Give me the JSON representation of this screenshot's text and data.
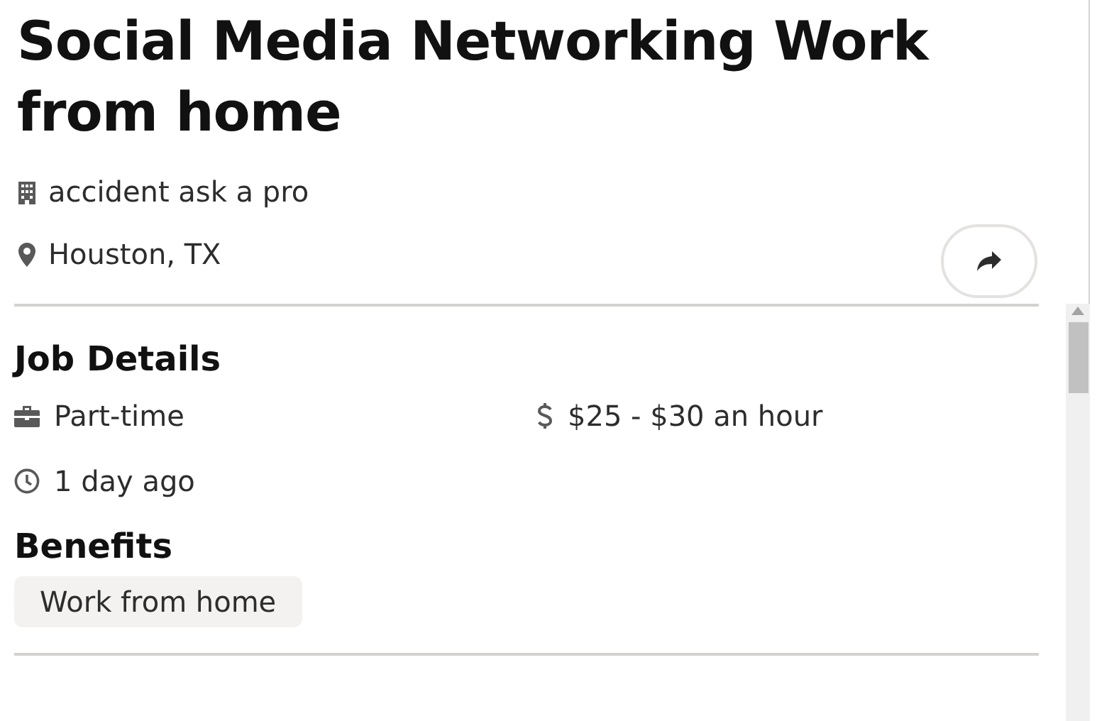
{
  "job": {
    "title": "Social Media Networking Work from home",
    "company": "accident ask a pro",
    "location": "Houston, TX"
  },
  "job_details": {
    "heading": "Job Details",
    "items": [
      {
        "kind": "job_type",
        "text": "Part-time"
      },
      {
        "kind": "pay",
        "text": "$25 - $30 an hour"
      },
      {
        "kind": "posted",
        "text": "1 day ago"
      }
    ]
  },
  "benefits": {
    "heading": "Benefits",
    "tags": [
      "Work from home"
    ]
  }
}
